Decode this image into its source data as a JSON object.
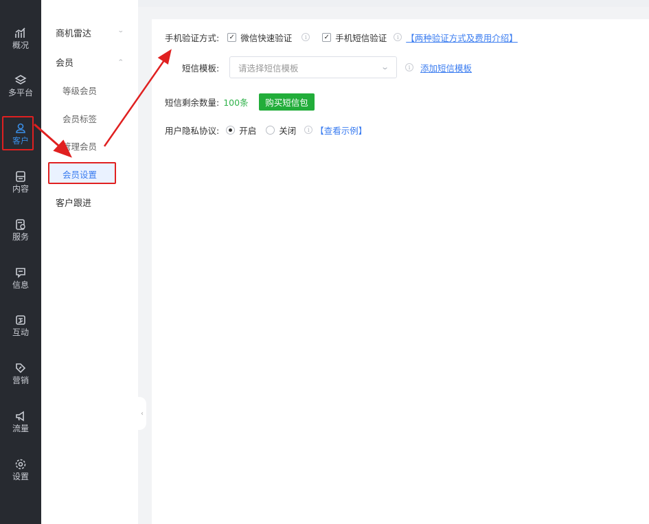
{
  "rail": {
    "items": [
      {
        "label": "概况",
        "icon": "chart-icon"
      },
      {
        "label": "多平台",
        "icon": "layers-icon"
      },
      {
        "label": "客户",
        "icon": "user-icon"
      },
      {
        "label": "内容",
        "icon": "document-icon"
      },
      {
        "label": "服务",
        "icon": "service-icon"
      },
      {
        "label": "信息",
        "icon": "message-icon"
      },
      {
        "label": "互动",
        "icon": "interact-icon"
      },
      {
        "label": "营销",
        "icon": "tag-icon"
      },
      {
        "label": "流量",
        "icon": "megaphone-icon"
      },
      {
        "label": "设置",
        "icon": "gear-icon"
      }
    ]
  },
  "submenu": {
    "groups": [
      {
        "label": "商机雷达",
        "caret": "⌄"
      },
      {
        "label": "会员",
        "caret": "⌃"
      }
    ],
    "member_items": [
      "等级会员",
      "会员标签",
      "管理会员",
      "会员设置"
    ],
    "follow": "客户跟进"
  },
  "form": {
    "verify_label": "手机验证方式:",
    "verify_opt1": "微信快速验证",
    "verify_opt2": "手机短信验证",
    "verify_link": "【两种验证方式及费用介绍】",
    "template_label": "短信模板:",
    "template_placeholder": "请选择短信模板",
    "template_link": "添加短信模板",
    "remain_label": "短信剩余数量:",
    "remain_value": "100条",
    "buy_button": "购买短信包",
    "privacy_label": "用户隐私协议:",
    "privacy_on": "开启",
    "privacy_off": "关闭",
    "privacy_link": "【查看示例】"
  },
  "colors": {
    "accent": "#3a7cf0",
    "highlight": "#e02020",
    "green": "#22ad3a",
    "rail_bg": "#272a30"
  }
}
